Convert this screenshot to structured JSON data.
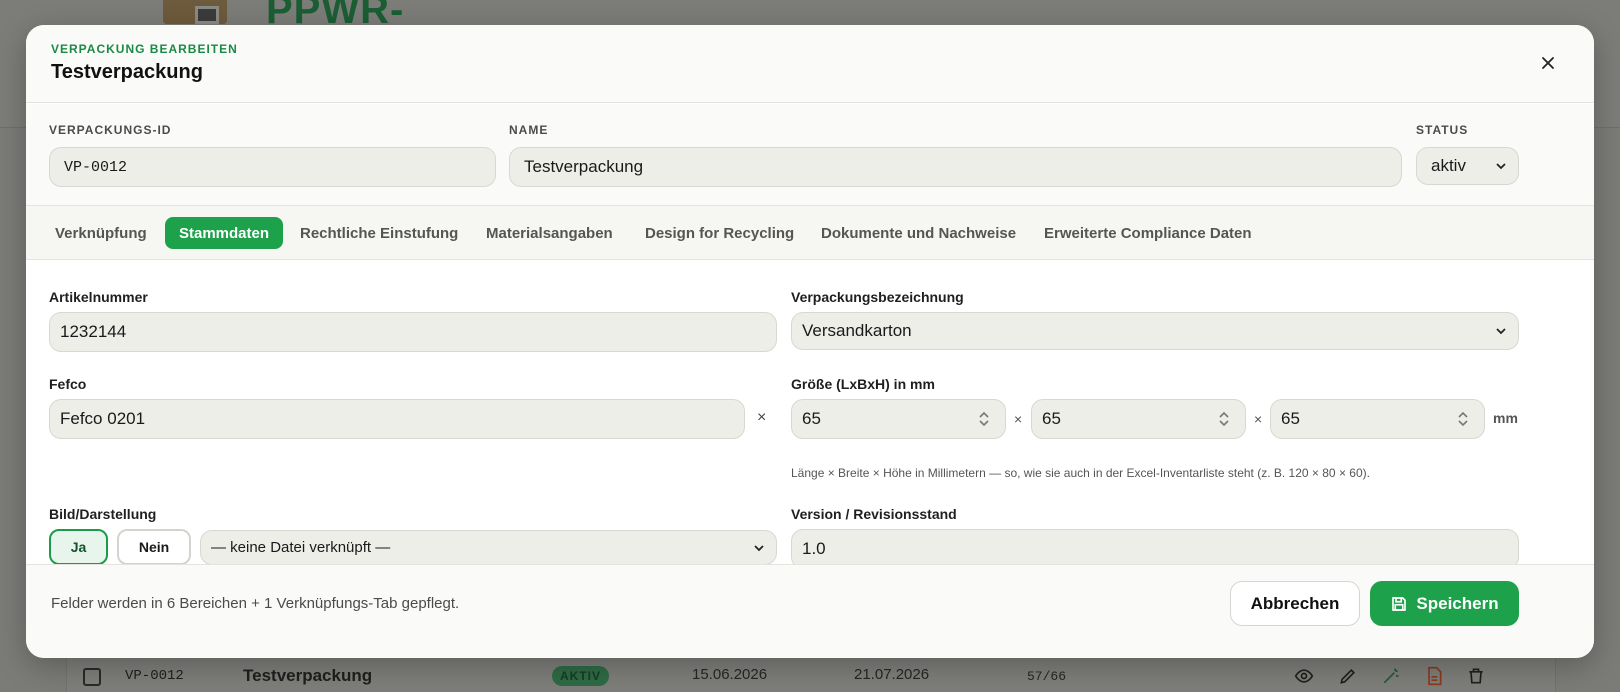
{
  "background": {
    "app_title": "PPWR-",
    "row": {
      "id": "VP-0012",
      "name": "Testverpackung",
      "status": "AKTIV",
      "date1": "15.06.2026",
      "date2": "21.07.2026",
      "score": "57/66"
    }
  },
  "modal": {
    "eyebrow": "VERPACKUNG BEARBEITEN",
    "title": "Testverpackung",
    "id_label": "VERPACKUNGS-ID",
    "id_value": "VP-0012",
    "name_label": "NAME",
    "name_value": "Testverpackung",
    "status_label": "STATUS",
    "status_value": "aktiv"
  },
  "tabs": [
    {
      "label": "Verknüpfung"
    },
    {
      "label": "Stammdaten"
    },
    {
      "label": "Rechtliche Einstufung"
    },
    {
      "label": "Materialsangaben"
    },
    {
      "label": "Design for Recycling"
    },
    {
      "label": "Dokumente und Nachweise"
    },
    {
      "label": "Erweiterte Compliance Daten"
    }
  ],
  "active_tab": "Stammdaten",
  "form": {
    "artikelnummer_label": "Artikelnummer",
    "artikelnummer_value": "1232144",
    "verpackungsbezeichnung_label": "Verpackungsbezeichnung",
    "verpackungsbezeichnung_value": "Versandkarton",
    "fefco_label": "Fefco",
    "fefco_value": "Fefco 0201",
    "clear_symbol": "×",
    "size_label": "Größe (LxBxH) in mm",
    "size_l": "65",
    "size_b": "65",
    "size_h": "65",
    "times": "×",
    "unit": "mm",
    "size_hint": "Länge × Breite × Höhe in Millimetern — so, wie sie auch in der Excel-Inventarliste steht (z. B. 120 × 80 × 60).",
    "bild_label": "Bild/Darstellung",
    "ja": "Ja",
    "nein": "Nein",
    "file_select": "— keine Datei verknüpft —",
    "version_label": "Version / Revisionsstand",
    "version_value": "1.0"
  },
  "footer": {
    "note": "Felder werden in 6 Bereichen + 1 Verknüpfungs-Tab gepflegt.",
    "cancel": "Abbrechen",
    "save": "Speichern"
  },
  "colors": {
    "accent": "#1ea14b",
    "eyebrow": "#1a8a45"
  }
}
